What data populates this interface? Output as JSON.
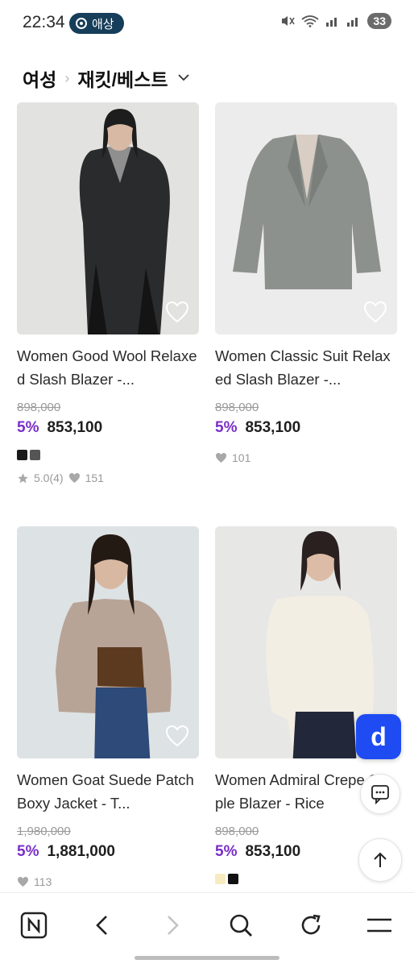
{
  "status_bar": {
    "time": "22:34",
    "network_badge": "애상",
    "battery": "33"
  },
  "breadcrumb": {
    "level1": "여성",
    "separator": "›",
    "level2": "재킷/베스트"
  },
  "products": [
    {
      "title": "Women Good Wool Relaxed Slash Blazer -...",
      "original_price": "898,000",
      "discount": "5%",
      "price": "853,100",
      "swatches": [
        "#1a1a1a",
        "#555555"
      ],
      "rating": "5.0(4)",
      "likes": "151"
    },
    {
      "title": "Women Classic Suit Relaxed Slash Blazer -...",
      "original_price": "898,000",
      "discount": "5%",
      "price": "853,100",
      "likes": "101"
    },
    {
      "title": "Women Goat Suede Patch Boxy Jacket - T...",
      "original_price": "1,980,000",
      "discount": "5%",
      "price": "1,881,000",
      "likes": "113"
    },
    {
      "title": "Women Admiral Crepe Staple Blazer - Rice",
      "original_price": "898,000",
      "discount": "5%",
      "price": "853,100",
      "swatches": [
        "#f7ebc0",
        "#111111"
      ]
    }
  ],
  "fab": {
    "d_label": "d"
  },
  "icons": {
    "heart": "heart-icon",
    "star": "star-icon"
  },
  "colors": {
    "discount": "#7a2ec7",
    "fab_blue": "#1e4cf2",
    "badge_bg": "#163d59"
  }
}
